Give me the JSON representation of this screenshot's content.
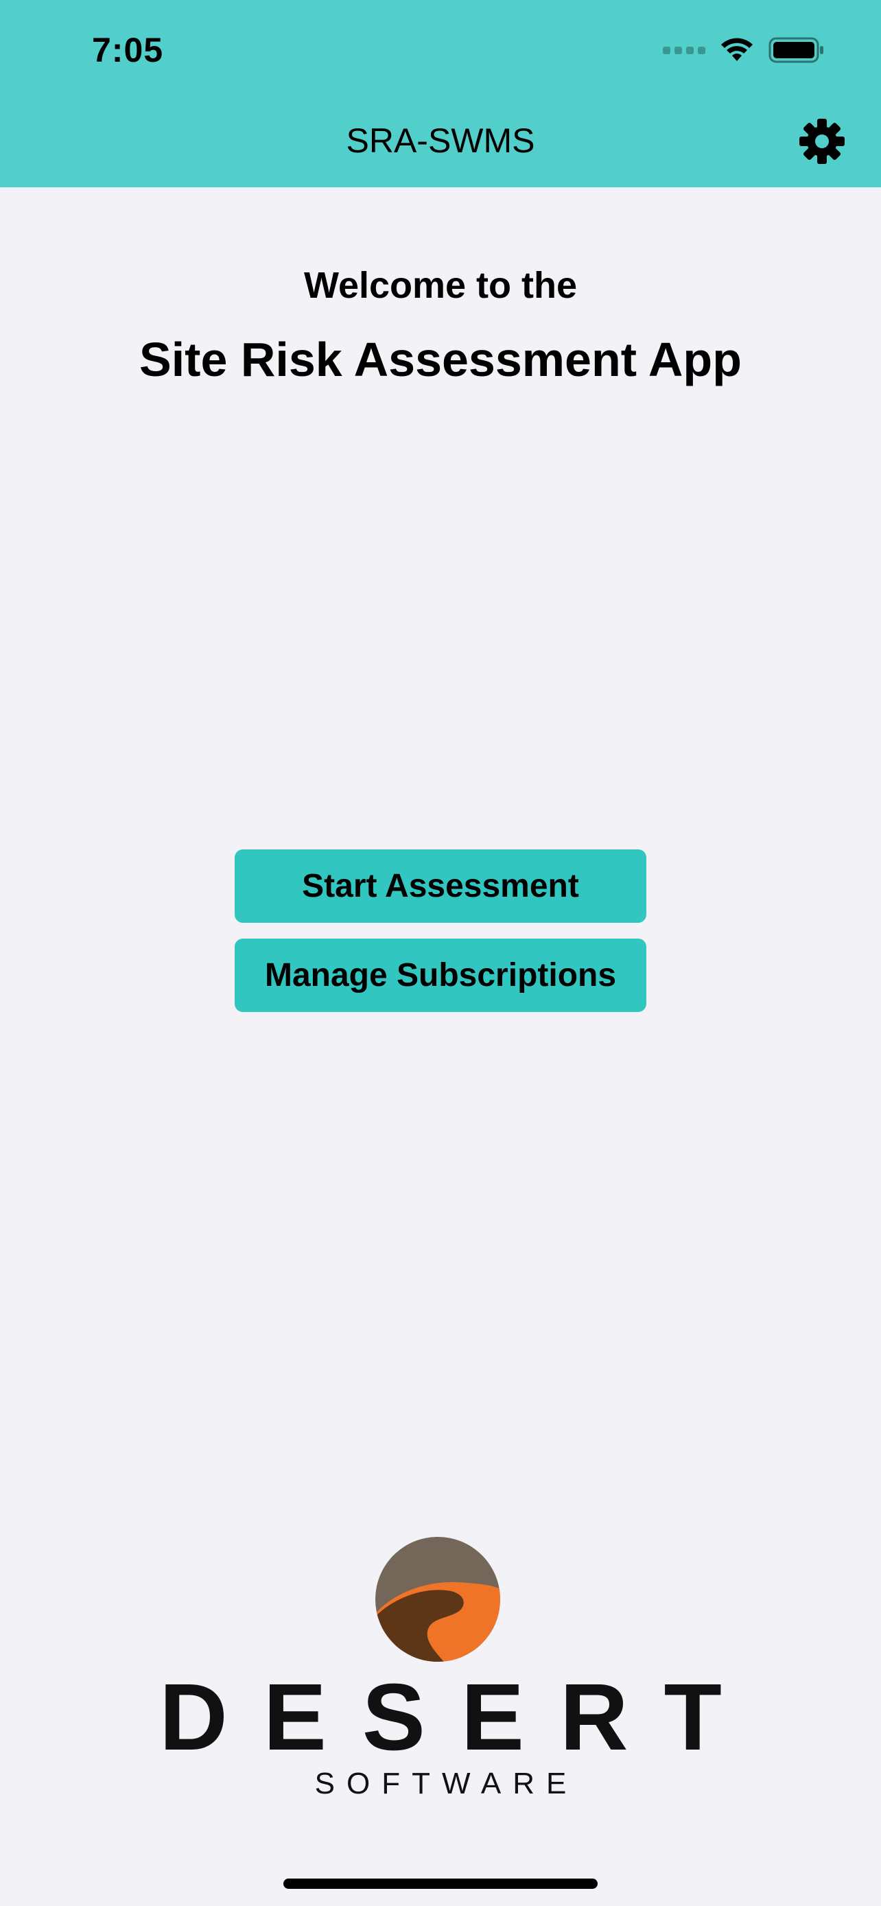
{
  "status_bar": {
    "time": "7:05",
    "icons": [
      "cellular-signal-icon",
      "wifi-icon",
      "battery-icon"
    ]
  },
  "nav_bar": {
    "title": "SRA-SWMS",
    "settings_icon": "gear-icon"
  },
  "welcome": {
    "line1": "Welcome to the",
    "app_name": "Site Risk Assessment App"
  },
  "actions": {
    "start_label": "Start Assessment",
    "manage_label": "Manage Subscriptions"
  },
  "logo": {
    "wordmark": "DESERT",
    "subtitle": "SOFTWARE"
  },
  "colors": {
    "header_bg": "#52cfca",
    "button_bg": "#32c6c1",
    "page_bg": "#f2f2f7",
    "logo_brown": "#5c3616",
    "logo_orange": "#f07427",
    "logo_taupe": "#74675a"
  }
}
